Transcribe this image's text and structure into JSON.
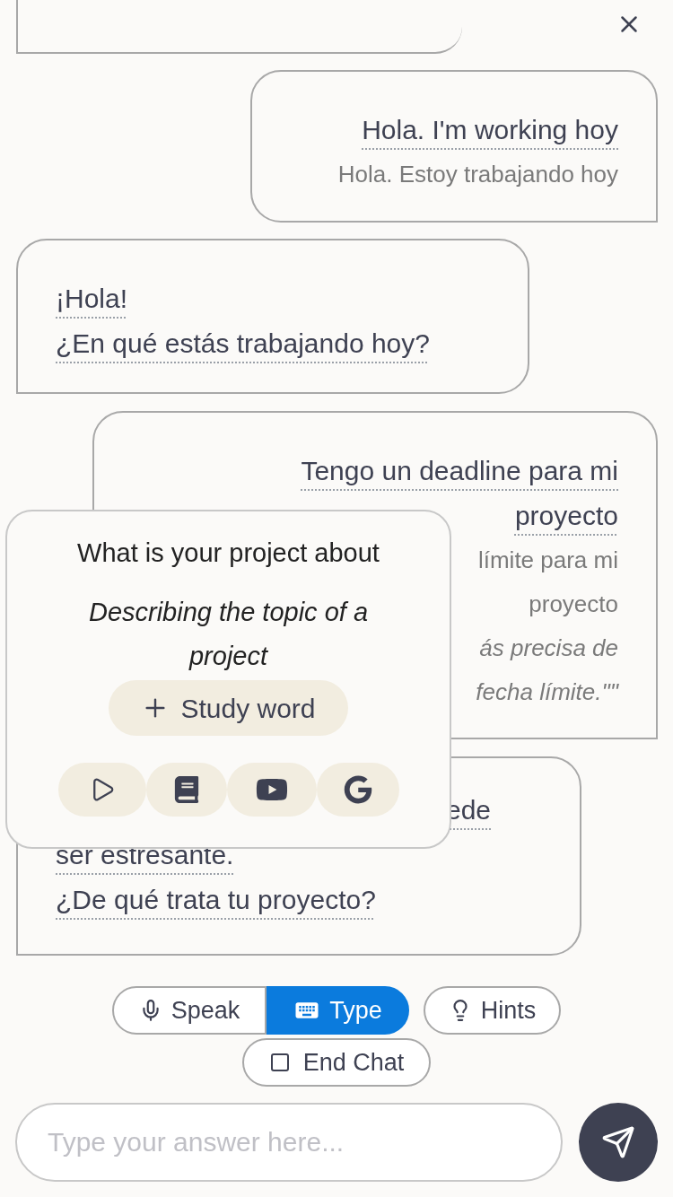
{
  "messages": [
    {
      "kind": "sent",
      "lines": [
        "Hola. I'm working hoy"
      ],
      "translation": [
        "Hola. Estoy trabajando hoy"
      ]
    },
    {
      "kind": "received",
      "lines": [
        "¡Hola!",
        "¿En qué estás trabajando hoy?"
      ]
    },
    {
      "kind": "sent",
      "lines": [
        "Tengo un deadline para mi",
        "proyecto"
      ],
      "translation": [
        "límite para mi",
        "proyecto"
      ],
      "note": [
        "ás precisa de",
        "fecha límite.\"\""
      ]
    },
    {
      "kind": "received",
      "lines": [
        "ede",
        "ser estresante.",
        "¿De qué trata tu proyecto?"
      ]
    }
  ],
  "popup": {
    "title": "What is your project about",
    "subtitle": "Describing the topic of a project",
    "study_button": "Study word"
  },
  "modes": [
    {
      "label": "Speak",
      "selected": false
    },
    {
      "label": "Type",
      "selected": true
    }
  ],
  "hints_button": "Hints",
  "end_button": "End Chat",
  "input": {
    "placeholder": "Type your answer here..."
  }
}
